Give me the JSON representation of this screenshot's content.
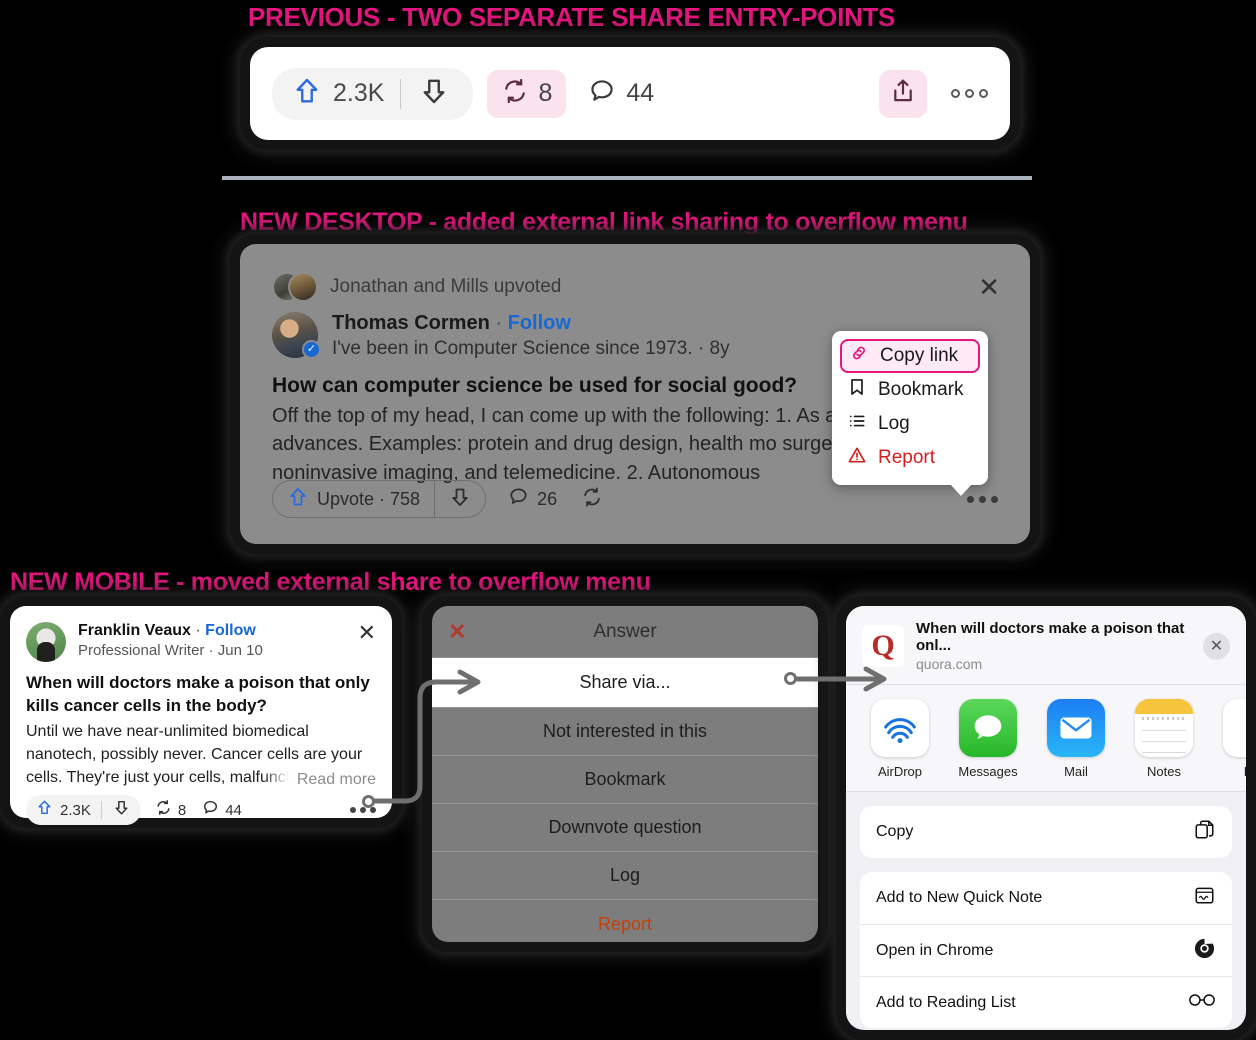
{
  "headings": {
    "previous": "PREVIOUS - TWO SEPARATE SHARE ENTRY-POINTS",
    "desktop": "NEW DESKTOP - added external link sharing to overflow menu",
    "mobile": "NEW MOBILE - moved external share to overflow menu"
  },
  "colors": {
    "accent_pink": "#e6157f",
    "link_blue": "#1868d4",
    "upvote_blue": "#1868d4",
    "report_red": "#d32020",
    "report_orange": "#c1410a",
    "chip_pink_bg": "#fbe3ee",
    "quora_red": "#b92b27"
  },
  "previous_bar": {
    "upvote_count": "2.3K",
    "repost_count": "8",
    "comment_count": "44",
    "icons": {
      "upvote": "upvote-arrow-icon",
      "downvote": "downvote-arrow-icon",
      "repost": "repost-cycle-icon",
      "comment": "comment-bubble-icon",
      "share": "share-box-arrow-icon",
      "more": "more-horizontal-icon"
    }
  },
  "desktop": {
    "upvoters_text": "Jonathan and Mills upvoted",
    "close_label": "✕",
    "author": {
      "name": "Thomas Cormen",
      "separator": "·",
      "follow": "Follow",
      "bio": "I've been in Computer Science since 1973. · 8y"
    },
    "question": "How can computer science be used for social good?",
    "answer_body": "Off the top of my head, I can come up with the following: 1. As a medical advances. Examples: protein and drug design, health mo surgery, noninvasive imaging, and telemedicine. 2. Autonomous",
    "actions": {
      "upvote_label": "Upvote · 758",
      "comment_count": "26",
      "repost_icon": "repost-cycle-icon",
      "downvote_icon": "downvote-arrow-icon",
      "more_icon": "more-horizontal-icon"
    },
    "menu": [
      {
        "label": "Copy link",
        "icon": "link-chain-icon",
        "selected": true,
        "danger": false
      },
      {
        "label": "Bookmark",
        "icon": "bookmark-icon",
        "selected": false,
        "danger": false
      },
      {
        "label": "Log",
        "icon": "list-icon",
        "selected": false,
        "danger": false
      },
      {
        "label": "Report",
        "icon": "warning-triangle-icon",
        "selected": false,
        "danger": true
      }
    ]
  },
  "mobile_post": {
    "author": {
      "name": "Franklin Veaux",
      "separator": "·",
      "follow": "Follow",
      "sub": "Professional Writer · Jun 10"
    },
    "close_label": "✕",
    "title": "When will doctors make a poison that only kills cancer cells in the body?",
    "body": "Until we have near-unlimited biomedical nanotech, possibly never. Cancer cells are your cells. They're just your cells, malfunctioning. But imagin",
    "read_more": "Read more",
    "actions": {
      "upvote_count": "2.3K",
      "repost_count": "8",
      "comment_count": "44",
      "more_icon": "more-horizontal-icon"
    }
  },
  "mobile_menu": {
    "header_title": "Answer",
    "close_label": "✕",
    "items": [
      {
        "label": "Share via...",
        "active": true,
        "danger": false
      },
      {
        "label": "Not interested in this",
        "active": false,
        "danger": false
      },
      {
        "label": "Bookmark",
        "active": false,
        "danger": false
      },
      {
        "label": "Downvote question",
        "active": false,
        "danger": false
      },
      {
        "label": "Log",
        "active": false,
        "danger": false
      },
      {
        "label": "Report",
        "active": false,
        "danger": true
      }
    ]
  },
  "share_sheet": {
    "logo_letter": "Q",
    "title": "When will doctors make a poison that onl...",
    "url": "quora.com",
    "close_label": "✕",
    "apps": [
      {
        "label": "AirDrop",
        "icon": "airdrop-icon"
      },
      {
        "label": "Messages",
        "icon": "messages-icon"
      },
      {
        "label": "Mail",
        "icon": "mail-icon"
      },
      {
        "label": "Notes",
        "icon": "notes-icon"
      },
      {
        "label": "Re",
        "icon": "reminders-icon"
      }
    ],
    "actions": [
      {
        "label": "Copy",
        "icon": "copy-documents-icon"
      },
      {
        "label": "Add to New Quick Note",
        "icon": "quick-note-icon"
      },
      {
        "label": "Open in Chrome",
        "icon": "chrome-icon"
      },
      {
        "label": "Add to Reading List",
        "icon": "glasses-icon"
      }
    ]
  }
}
